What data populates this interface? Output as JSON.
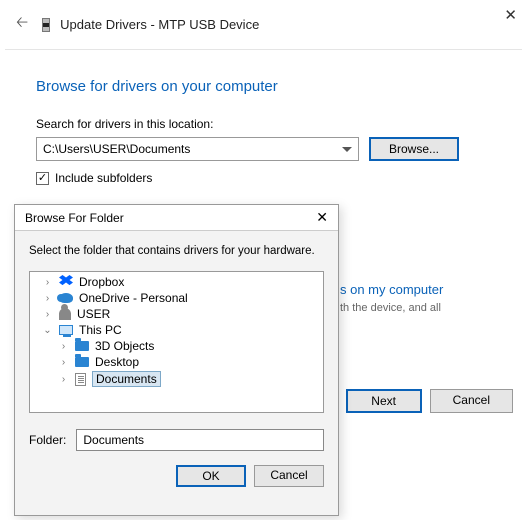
{
  "window": {
    "title": "Update Drivers - MTP USB Device"
  },
  "main": {
    "heading": "Browse for drivers on your computer",
    "search_label": "Search for drivers in this location:",
    "location_value": "C:\\Users\\USER\\Documents",
    "browse_button": "Browse...",
    "include_subfolders": "Include subfolders",
    "bg_link_text": "s on my computer",
    "bg_sub_text": "th the device, and all",
    "next_button": "Next",
    "cancel_button": "Cancel"
  },
  "dialog": {
    "title": "Browse For Folder",
    "instruction": "Select the folder that contains drivers for your hardware.",
    "tree": {
      "dropbox": "Dropbox",
      "onedrive": "OneDrive - Personal",
      "user": "USER",
      "thispc": "This PC",
      "objects3d": "3D Objects",
      "desktop": "Desktop",
      "documents": "Documents"
    },
    "folder_label": "Folder:",
    "folder_value": "Documents",
    "ok_button": "OK",
    "cancel_button": "Cancel"
  }
}
